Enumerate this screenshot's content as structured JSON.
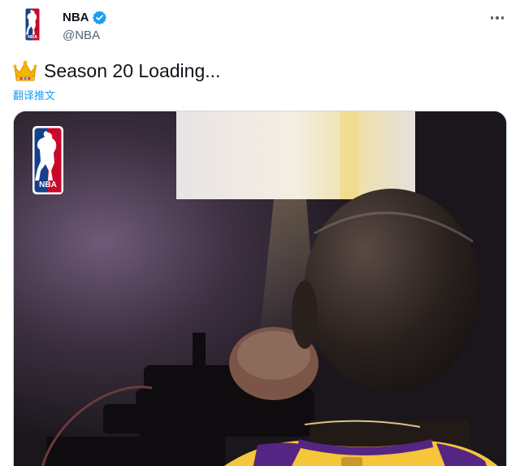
{
  "tweet": {
    "display_name": "NBA",
    "handle": "@NBA",
    "text": "Season 20 Loading...",
    "translate_label": "翻译推文"
  },
  "icons": {
    "avatar": "nba-logo-icon",
    "verified": "verified-badge-icon",
    "more": "more-options-icon",
    "emoji": "crown-emoji-icon"
  },
  "colors": {
    "accent": "#1d9bf0",
    "text": "#0f1419",
    "secondary": "#536471",
    "nba_blue": "#17408B",
    "nba_red": "#C9082A",
    "lakers_gold": "#FDB927",
    "lakers_purple": "#552583"
  }
}
